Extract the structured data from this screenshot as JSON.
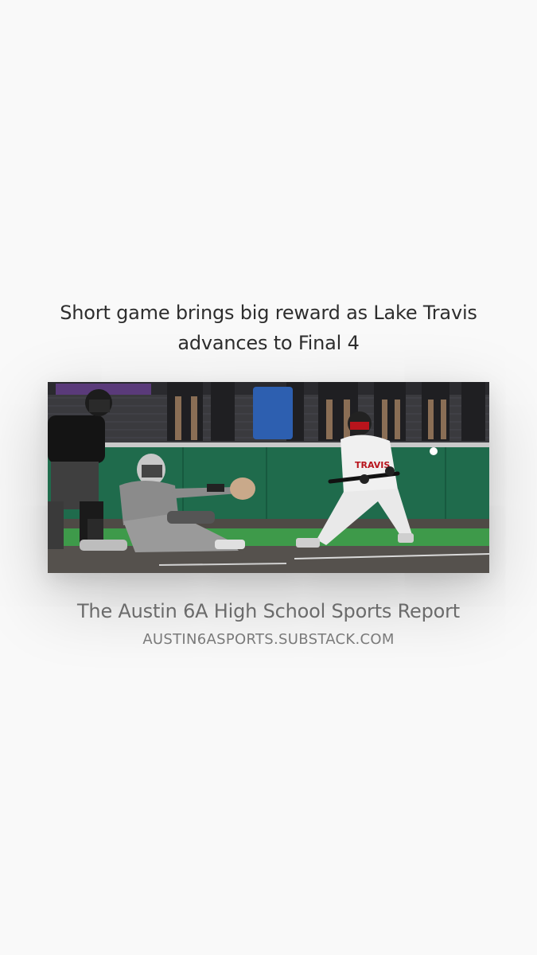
{
  "post": {
    "headline": "Short game brings big reward as Lake Travis advances to Final 4",
    "photo_alt": "Lake Travis batter squaring to bunt while catcher reaches and umpire watches",
    "jersey_text": "TRAVIS"
  },
  "publication": {
    "name": "The Austin 6A High School Sports Report",
    "domain": "AUSTIN6ASPORTS.SUBSTACK.COM"
  },
  "colors": {
    "background": "#f9f9f9",
    "headline": "#2e2e2e",
    "publication_name": "#6b6b6b",
    "publication_domain": "#7a7a7a",
    "outfield_wall": "#1f6b4c",
    "turf": "#3e9a4a"
  }
}
